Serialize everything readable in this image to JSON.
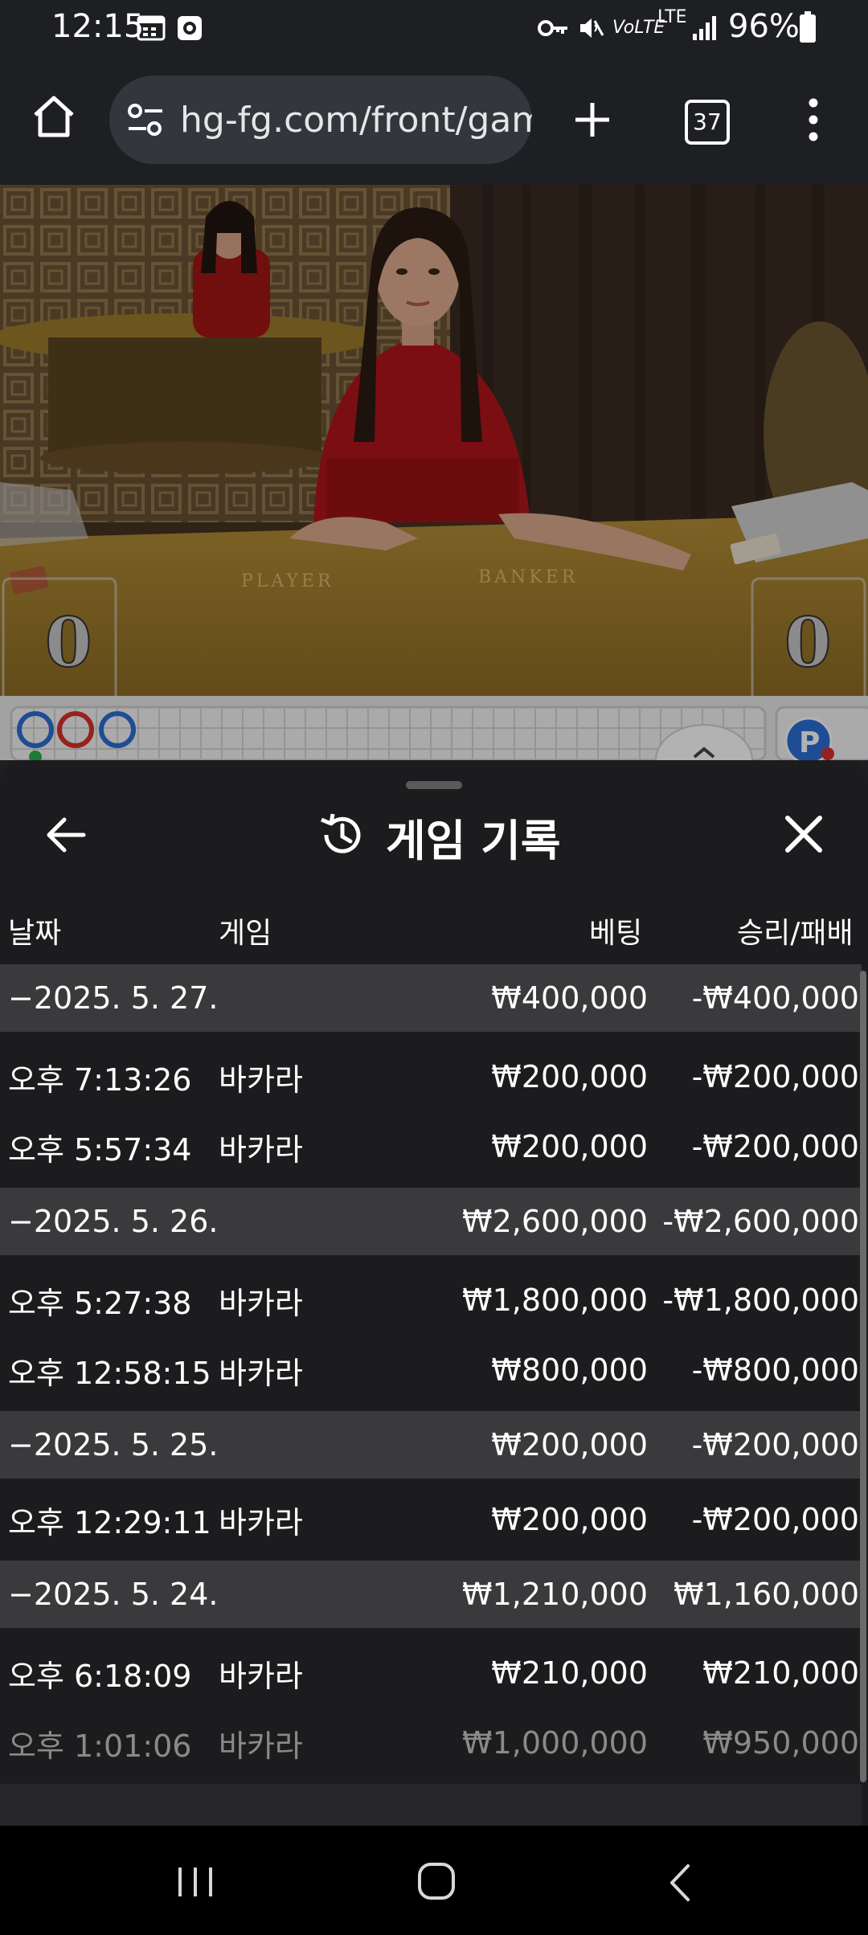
{
  "status_bar": {
    "time": "12:15",
    "battery": "96%",
    "network": "LTE"
  },
  "browser": {
    "url": "hg-fg.com/front/gam",
    "tab_count": "37"
  },
  "video": {
    "player_score": "0",
    "banker_score": "0",
    "table_player_label": "PLAYER",
    "table_banker_label": "BANKER"
  },
  "sheet": {
    "title": "게임 기록",
    "columns": {
      "date": "날짜",
      "game": "게임",
      "bet": "베팅",
      "win_loss": "승리/패배"
    },
    "groups": [
      {
        "date": "−2025. 5. 27.",
        "bet": "₩400,000",
        "win_loss": "-₩400,000",
        "rows": [
          {
            "time": "오후 7:13:26",
            "game": "바카라",
            "bet": "₩200,000",
            "win_loss": "-₩200,000"
          },
          {
            "time": "오후 5:57:34",
            "game": "바카라",
            "bet": "₩200,000",
            "win_loss": "-₩200,000"
          }
        ]
      },
      {
        "date": "−2025. 5. 26.",
        "bet": "₩2,600,000",
        "win_loss": "-₩2,600,000",
        "rows": [
          {
            "time": "오후 5:27:38",
            "game": "바카라",
            "bet": "₩1,800,000",
            "win_loss": "-₩1,800,000"
          },
          {
            "time": "오후 12:58:15",
            "game": "바카라",
            "bet": "₩800,000",
            "win_loss": "-₩800,000"
          }
        ]
      },
      {
        "date": "−2025. 5. 25.",
        "bet": "₩200,000",
        "win_loss": "-₩200,000",
        "rows": [
          {
            "time": "오후 12:29:11",
            "game": "바카라",
            "bet": "₩200,000",
            "win_loss": "-₩200,000"
          }
        ]
      },
      {
        "date": "−2025. 5. 24.",
        "bet": "₩1,210,000",
        "win_loss": "₩1,160,000",
        "rows": [
          {
            "time": "오후 6:18:09",
            "game": "바카라",
            "bet": "₩210,000",
            "win_loss": "₩210,000"
          },
          {
            "time": "오후 1:01:06",
            "game": "바카라",
            "bet": "₩1,000,000",
            "win_loss": "₩950,000"
          }
        ]
      }
    ]
  },
  "icons": {
    "home": "home-icon",
    "site_settings": "tune-icon",
    "new_tab": "plus-icon",
    "menu": "more-vert-icon",
    "back": "arrow-left-icon",
    "history": "history-icon",
    "close": "close-icon"
  }
}
